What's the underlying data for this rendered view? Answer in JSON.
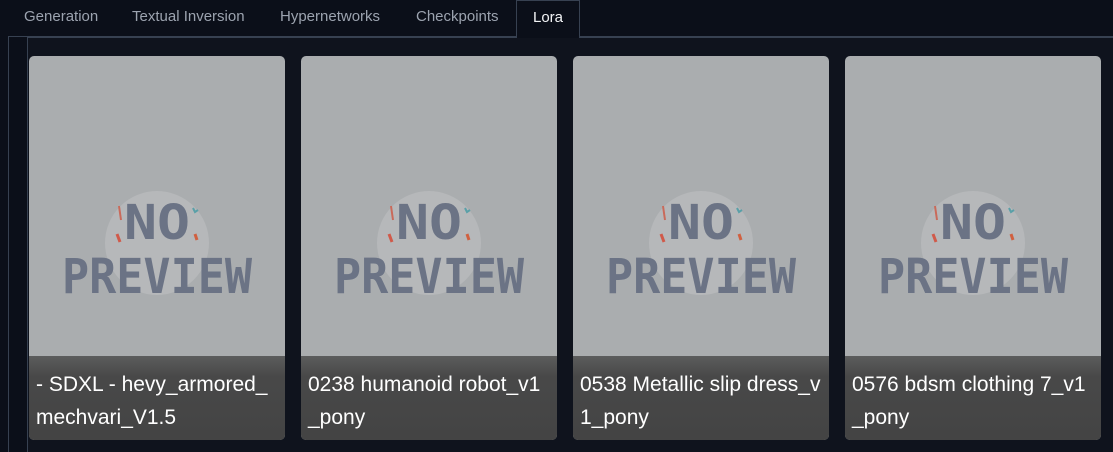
{
  "tabs": [
    {
      "label": "Generation",
      "active": false
    },
    {
      "label": "Textual Inversion",
      "active": false
    },
    {
      "label": "Hypernetworks",
      "active": false
    },
    {
      "label": "Checkpoints",
      "active": false
    },
    {
      "label": "Lora",
      "active": true
    }
  ],
  "placeholder": {
    "line1": "NO",
    "line2": "PREVIEW"
  },
  "cards": [
    {
      "name": "- SDXL - hevy_armored_mechvari_V1.5"
    },
    {
      "name": "0238 humanoid robot_v1_pony"
    },
    {
      "name": "0538 Metallic slip dress_v1_pony"
    },
    {
      "name": "0576 bdsm clothing 7_v1_pony"
    }
  ],
  "colors": {
    "background": "#0b0f19",
    "card_bg": "#aaadaf",
    "placeholder_text": "#6b7385",
    "label_bg": "#444444",
    "tab_active_text": "#f3f4f6",
    "tab_text": "#9ca3af"
  }
}
